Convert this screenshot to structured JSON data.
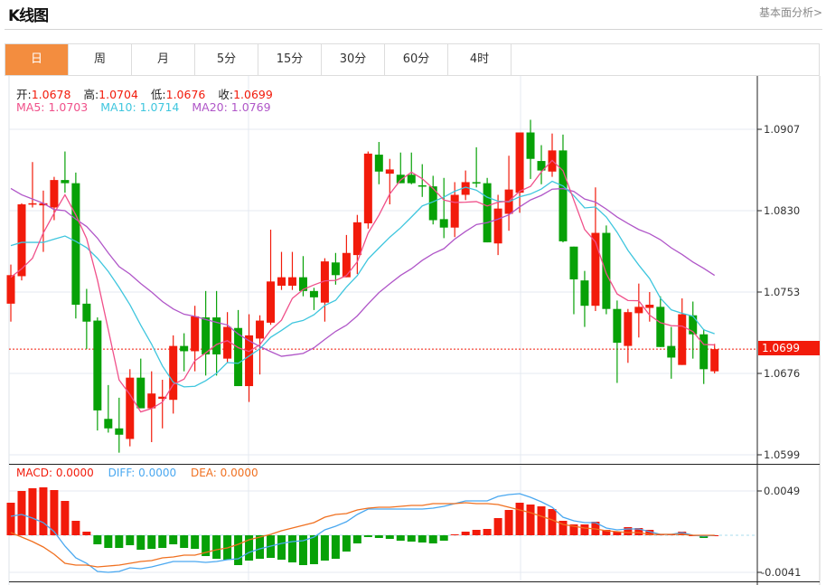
{
  "header": {
    "title": "K线图",
    "link": "基本面分析>"
  },
  "tabs": [
    "日",
    "周",
    "月",
    "5分",
    "15分",
    "30分",
    "60分",
    "4时"
  ],
  "active_tab": 0,
  "ohlc": {
    "open_label": "开:",
    "open": "1.0678",
    "high_label": "高:",
    "high": "1.0704",
    "low_label": "低:",
    "low": "1.0676",
    "close_label": "收:",
    "close": "1.0699"
  },
  "ma_legend": {
    "ma5": "MA5: 1.0703",
    "ma10": "MA10: 1.0714",
    "ma20": "MA20: 1.0769"
  },
  "macd_legend": {
    "macd": "MACD: 0.0000",
    "diff": "DIFF: 0.0000",
    "dea": "DEA: 0.0000"
  },
  "colors": {
    "up": "#f21b0b",
    "down": "#07a107",
    "ma5": "#f0508a",
    "ma10": "#3fc6de",
    "ma20": "#b056c8",
    "diff": "#4aa8f0",
    "dea": "#f07020",
    "accent": "#f38d3f"
  },
  "price_axis": [
    "1.0907",
    "1.0830",
    "1.0753",
    "1.0676",
    "1.0599"
  ],
  "macd_axis": [
    "0.0049",
    "-0.0041"
  ],
  "last_price_tag": "1.0699",
  "chart_data": {
    "type": "candlestick",
    "price_range": [
      1.0599,
      1.0907
    ],
    "macd_range": [
      -0.0041,
      0.0049
    ],
    "candles": [
      [
        1.0742,
        1.0779,
        1.0725,
        1.0769
      ],
      [
        1.0768,
        1.0837,
        1.0764,
        1.0836
      ],
      [
        1.0836,
        1.0876,
        1.0833,
        1.0837
      ],
      [
        1.0835,
        1.0849,
        1.0791,
        1.0837
      ],
      [
        1.0833,
        1.0862,
        1.0821,
        1.0859
      ],
      [
        1.0859,
        1.0886,
        1.0847,
        1.0856
      ],
      [
        1.0856,
        1.0866,
        1.0728,
        1.0741
      ],
      [
        1.0742,
        1.0756,
        1.0699,
        1.0725
      ],
      [
        1.0726,
        1.0729,
        1.0622,
        1.0641
      ],
      [
        1.0633,
        1.0665,
        1.062,
        1.0624
      ],
      [
        1.0624,
        1.0653,
        1.0601,
        1.0618
      ],
      [
        1.0614,
        1.068,
        1.0607,
        1.0672
      ],
      [
        1.0672,
        1.069,
        1.0643,
        1.0643
      ],
      [
        1.0643,
        1.0678,
        1.0611,
        1.0657
      ],
      [
        1.0652,
        1.067,
        1.0624,
        1.0654
      ],
      [
        1.0651,
        1.0712,
        1.0638,
        1.0702
      ],
      [
        1.0702,
        1.0714,
        1.0678,
        1.0697
      ],
      [
        1.0697,
        1.074,
        1.0678,
        1.073
      ],
      [
        1.0729,
        1.0754,
        1.0674,
        1.0694
      ],
      [
        1.0729,
        1.0754,
        1.0674,
        1.0694
      ],
      [
        1.069,
        1.0734,
        1.0686,
        1.072
      ],
      [
        1.0719,
        1.0736,
        1.0664,
        1.0664
      ],
      [
        1.0664,
        1.0732,
        1.0649,
        1.0712
      ],
      [
        1.0709,
        1.0731,
        1.0675,
        1.0726
      ],
      [
        1.0724,
        1.0812,
        1.0722,
        1.0763
      ],
      [
        1.0759,
        1.0791,
        1.0755,
        1.0767
      ],
      [
        1.0759,
        1.0791,
        1.0755,
        1.0767
      ],
      [
        1.0767,
        1.0787,
        1.0749,
        1.0754
      ],
      [
        1.0754,
        1.0757,
        1.0736,
        1.0748
      ],
      [
        1.0743,
        1.0785,
        1.0725,
        1.0782
      ],
      [
        1.0781,
        1.079,
        1.076,
        1.0769
      ],
      [
        1.0767,
        1.0807,
        1.0767,
        1.079
      ],
      [
        1.0788,
        1.0826,
        1.077,
        1.0819
      ],
      [
        1.0818,
        1.0886,
        1.0813,
        1.0884
      ],
      [
        1.0883,
        1.0895,
        1.0855,
        1.0867
      ],
      [
        1.0865,
        1.0879,
        1.0836,
        1.0869
      ],
      [
        1.0864,
        1.0885,
        1.0856,
        1.0856
      ],
      [
        1.0864,
        1.0885,
        1.0855,
        1.0856
      ],
      [
        1.0854,
        1.0874,
        1.0843,
        1.0853
      ],
      [
        1.0853,
        1.0863,
        1.0817,
        1.0821
      ],
      [
        1.0822,
        1.0861,
        1.0804,
        1.0814
      ],
      [
        1.0814,
        1.0857,
        1.0805,
        1.0845
      ],
      [
        1.0845,
        1.0868,
        1.084,
        1.0857
      ],
      [
        1.0857,
        1.089,
        1.0852,
        1.0856
      ],
      [
        1.0856,
        1.0861,
        1.08,
        1.08
      ],
      [
        1.0799,
        1.0845,
        1.0788,
        1.0832
      ],
      [
        1.0827,
        1.0882,
        1.0811,
        1.085
      ],
      [
        1.0847,
        1.0904,
        1.0828,
        1.0904
      ],
      [
        1.0904,
        1.0916,
        1.086,
        1.0879
      ],
      [
        1.0877,
        1.0892,
        1.0855,
        1.0868
      ],
      [
        1.0867,
        1.0903,
        1.0862,
        1.0887
      ],
      [
        1.0887,
        1.0902,
        1.08,
        1.0801
      ],
      [
        1.0796,
        1.0796,
        1.0732,
        1.0765
      ],
      [
        1.0764,
        1.0773,
        1.072,
        1.074
      ],
      [
        1.074,
        1.0852,
        1.0735,
        1.0809
      ],
      [
        1.0809,
        1.0816,
        1.0732,
        1.0737
      ],
      [
        1.0737,
        1.0745,
        1.0667,
        1.0705
      ],
      [
        1.0702,
        1.0737,
        1.0686,
        1.0734
      ],
      [
        1.0733,
        1.0761,
        1.071,
        1.0739
      ],
      [
        1.0738,
        1.0753,
        1.0725,
        1.0741
      ],
      [
        1.0739,
        1.0749,
        1.0701,
        1.0701
      ],
      [
        1.0702,
        1.072,
        1.0671,
        1.0691
      ],
      [
        1.0684,
        1.0747,
        1.0684,
        1.0732
      ],
      [
        1.0731,
        1.0744,
        1.069,
        1.0713
      ],
      [
        1.0713,
        1.0718,
        1.0666,
        1.068
      ],
      [
        1.0678,
        1.0704,
        1.0676,
        1.0699
      ]
    ],
    "ma5_lead": [
      1.0767,
      1.0775,
      1.0785,
      1.0809
    ],
    "ma10_lead": [
      1.0797,
      1.08,
      1.08,
      1.08,
      1.0803,
      1.0806,
      1.0801,
      1.0795,
      1.0785
    ],
    "ma20_lead": [
      1.0851,
      1.0845,
      1.0841,
      1.0837,
      1.0831,
      1.083,
      1.0822,
      1.0815,
      1.0804,
      1.079,
      1.0777,
      1.077,
      1.0761,
      1.0753,
      1.0744,
      1.0737,
      1.0732,
      1.073,
      1.0727
    ],
    "macd_hist": [
      0.0036,
      0.0049,
      0.0052,
      0.0053,
      0.005,
      0.0038,
      0.0016,
      0.0004,
      -0.001,
      -0.0014,
      -0.0014,
      -0.0011,
      -0.0016,
      -0.0015,
      -0.0014,
      -0.001,
      -0.0014,
      -0.0015,
      -0.0023,
      -0.0026,
      -0.0027,
      -0.0033,
      -0.0028,
      -0.0026,
      -0.0025,
      -0.0027,
      -0.003,
      -0.0033,
      -0.0032,
      -0.0028,
      -0.0026,
      -0.0018,
      -0.0009,
      -0.0002,
      -0.0003,
      -0.0004,
      -0.0006,
      -0.0007,
      -0.0008,
      -0.0009,
      -0.0006,
      0.0001,
      0.0004,
      0.0006,
      0.0007,
      0.0019,
      0.0028,
      0.0036,
      0.0034,
      0.0032,
      0.0029,
      0.0016,
      0.0012,
      0.0012,
      0.0015,
      0.0006,
      0.0004,
      0.0009,
      0.0008,
      0.0006,
      0.0001,
      0.0001,
      0.0004,
      0.0,
      -0.0003,
      0.0
    ],
    "diff": [
      0.0021,
      0.0023,
      0.0019,
      0.0014,
      0.0004,
      -0.0012,
      -0.0025,
      -0.0031,
      -0.004,
      -0.0041,
      -0.004,
      -0.0036,
      -0.0037,
      -0.0035,
      -0.0032,
      -0.0029,
      -0.0029,
      -0.0029,
      -0.003,
      -0.0029,
      -0.0027,
      -0.0026,
      -0.0019,
      -0.0015,
      -0.0012,
      -0.0009,
      -0.0007,
      -0.0006,
      -0.0002,
      0.0006,
      0.001,
      0.0015,
      0.0023,
      0.0029,
      0.0029,
      0.0029,
      0.0029,
      0.0029,
      0.0029,
      0.003,
      0.0032,
      0.0035,
      0.0038,
      0.0038,
      0.0038,
      0.0043,
      0.0045,
      0.0046,
      0.0042,
      0.0037,
      0.0031,
      0.002,
      0.0016,
      0.0014,
      0.0014,
      0.0008,
      0.0006,
      0.0007,
      0.0007,
      0.0004,
      0.0001,
      0.0001,
      0.0003,
      0.0,
      -0.0001,
      0.0
    ],
    "dea": [
      0.0003,
      -0.0002,
      -0.0007,
      -0.0013,
      -0.0021,
      -0.0031,
      -0.0033,
      -0.0033,
      -0.0035,
      -0.0034,
      -0.0033,
      -0.0031,
      -0.0029,
      -0.0028,
      -0.0025,
      -0.0024,
      -0.0022,
      -0.0022,
      -0.0019,
      -0.0016,
      -0.0014,
      -0.001,
      -0.0005,
      -0.0002,
      0.0001,
      0.0005,
      0.0008,
      0.0011,
      0.0014,
      0.002,
      0.0023,
      0.0024,
      0.0028,
      0.003,
      0.0031,
      0.0031,
      0.0032,
      0.0033,
      0.0033,
      0.0035,
      0.0035,
      0.0035,
      0.0036,
      0.0035,
      0.0035,
      0.0034,
      0.0031,
      0.0028,
      0.0025,
      0.0021,
      0.0017,
      0.0012,
      0.001,
      0.0008,
      0.0007,
      0.0005,
      0.0004,
      0.0003,
      0.0003,
      0.0001,
      0.0001,
      0.0001,
      0.0001,
      0.0,
      0.0,
      0.0
    ]
  }
}
